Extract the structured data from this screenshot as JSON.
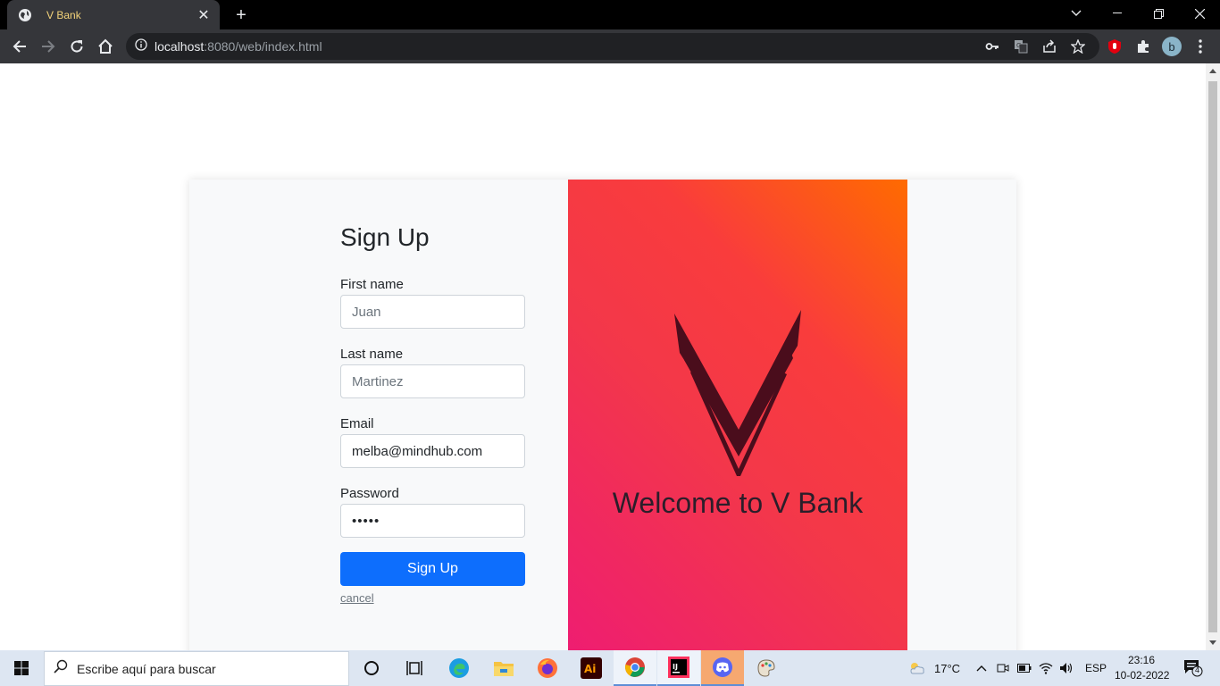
{
  "browser": {
    "tab_title": "V Bank",
    "url_host": "localhost",
    "url_rest": ":8080/web/index.html",
    "profile_initial": "b"
  },
  "form": {
    "title": "Sign Up",
    "first_name_label": "First name",
    "first_name_placeholder": "Juan",
    "last_name_label": "Last name",
    "last_name_placeholder": "Martinez",
    "email_label": "Email",
    "email_value": "melba@mindhub.com",
    "password_label": "Password",
    "password_value": "•••••",
    "submit_label": "Sign Up",
    "cancel_label": "cancel"
  },
  "hero": {
    "welcome_text": "Welcome to V Bank",
    "gradient_colors": [
      "#ff6b00",
      "#f93c3c",
      "#ee1b74"
    ]
  },
  "taskbar": {
    "search_placeholder": "Escribe aquí para buscar",
    "weather": "17°C",
    "language": "ESP",
    "time": "23:16",
    "date": "10-02-2022",
    "notifications_count": "4"
  },
  "colors": {
    "primary_button": "#0d6efd",
    "card_bg": "#f8f9fa"
  }
}
